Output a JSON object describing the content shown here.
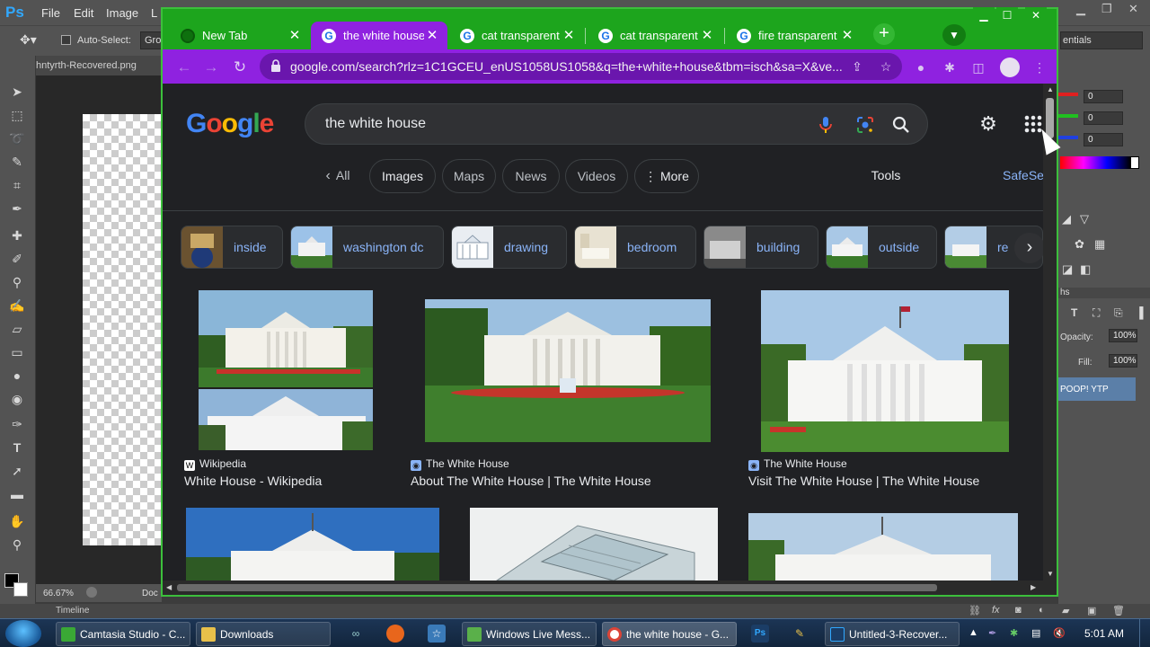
{
  "photoshop": {
    "menu": [
      "File",
      "Edit",
      "Image",
      "L"
    ],
    "options_bar": {
      "auto_select_label": "Auto-Select:",
      "group_value": "Gro",
      "workspace": "entials"
    },
    "doc_tab": "hntyrth-Recovered.png",
    "zoom": "66.67%",
    "doc_label": "Doc",
    "timeline_label": "Timeline",
    "color_values": [
      "0",
      "0",
      "0"
    ],
    "opacity_label": "Opacity:",
    "opacity_value": "100%",
    "fill_label": "Fill:",
    "fill_value": "100%",
    "layer_name": "POOP! YTP",
    "panel_tab": "hs",
    "colors": {
      "bg": "#535353",
      "canvas_area": "#282828"
    }
  },
  "chrome": {
    "tabs": [
      {
        "label": "New Tab",
        "icon": "chrome-icon",
        "active": false
      },
      {
        "label": "the white house",
        "icon": "google-icon",
        "active": true
      },
      {
        "label": "cat transparent p",
        "icon": "google-icon",
        "active": false
      },
      {
        "label": "cat transparent p",
        "icon": "google-icon",
        "active": false
      },
      {
        "label": "fire transparent p",
        "icon": "google-icon",
        "active": false
      }
    ],
    "new_tab_symbol": "+",
    "url": "google.com/search?rlz=1C1GCEU_enUS1058US1058&q=the+white+house&tbm=isch&sa=X&ve...",
    "colors": {
      "tabstrip": "#1da51d",
      "toolbar": "#8f22e0",
      "border": "#3cbf3c",
      "page_bg": "#202124",
      "link": "#8ab4f8"
    }
  },
  "google": {
    "logo_letters": [
      {
        "ch": "G",
        "color": "#4285f4"
      },
      {
        "ch": "o",
        "color": "#ea4335"
      },
      {
        "ch": "o",
        "color": "#fbbc05"
      },
      {
        "ch": "g",
        "color": "#4285f4"
      },
      {
        "ch": "l",
        "color": "#34a853"
      },
      {
        "ch": "e",
        "color": "#ea4335"
      }
    ],
    "query": "the white house",
    "filters": [
      "All",
      "Images",
      "Maps",
      "News",
      "Videos",
      "More"
    ],
    "tools_label": "Tools",
    "safesearch_label": "SafeSe",
    "related": [
      "inside",
      "washington dc",
      "drawing",
      "bedroom",
      "building",
      "outside",
      "re"
    ],
    "results": [
      {
        "source": "Wikipedia",
        "title": "White House - Wikipedia"
      },
      {
        "source": "The White House",
        "title": "About The White House | The White House"
      },
      {
        "source": "The White House",
        "title": "Visit The White House | The White House"
      }
    ]
  },
  "taskbar": {
    "items": [
      {
        "label": "Camtasia Studio - C...",
        "color": "#3aa835"
      },
      {
        "label": "Downloads",
        "color": "#e8c04a"
      },
      {
        "label": "Windows Live Mess...",
        "color": "#5ab04a"
      },
      {
        "label": "the white house - G...",
        "color": "#ffffff"
      },
      {
        "label": "Untitled-3-Recover...",
        "color": "#31a8ff"
      }
    ],
    "time": "5:01 AM"
  }
}
